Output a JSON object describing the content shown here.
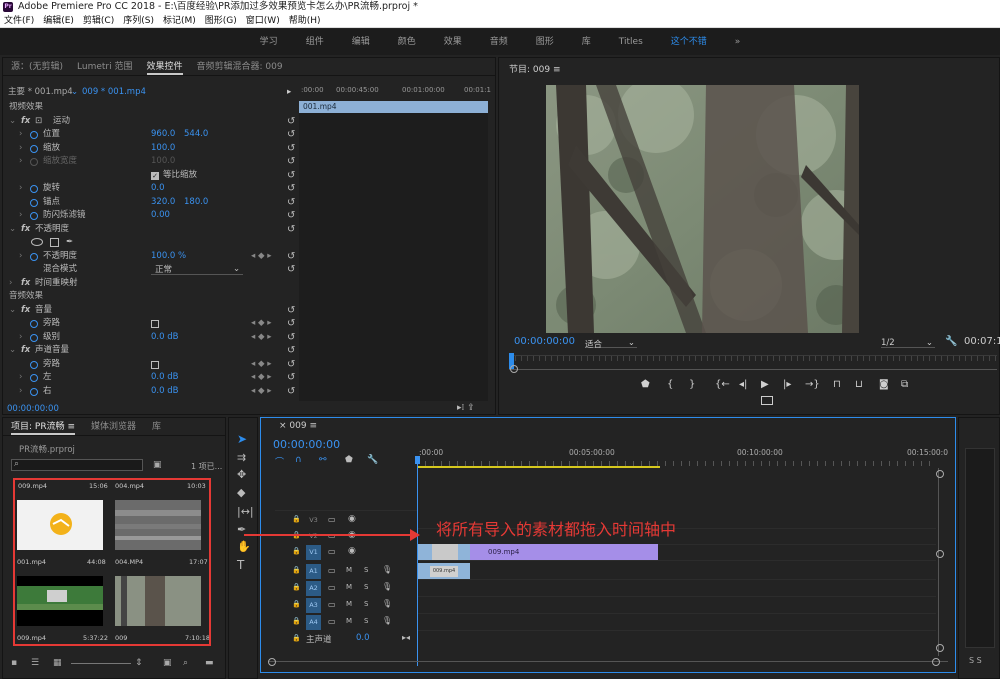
{
  "window": {
    "title": "Adobe Premiere Pro CC 2018 - E:\\百度经验\\PR添加过多效果预览卡怎么办\\PR流畅.prproj *"
  },
  "menu": [
    "文件(F)",
    "编辑(E)",
    "剪辑(C)",
    "序列(S)",
    "标记(M)",
    "图形(G)",
    "窗口(W)",
    "帮助(H)"
  ],
  "workspaces": [
    "学习",
    "组件",
    "编辑",
    "颜色",
    "效果",
    "音频",
    "图形",
    "库",
    "Titles",
    "这个不错",
    "»"
  ],
  "effect_controls": {
    "tabs": [
      "源：(无剪辑)",
      "Lumetri 范围",
      "效果控件",
      "音频剪辑混合器: 009"
    ],
    "master": "主要 * 001.mp4",
    "clip": "009 * 001.mp4",
    "ruler": [
      ":00:00",
      "00:00:45:00",
      "00:01:00:00",
      "00:01:1"
    ],
    "clip_bar": "001.mp4",
    "video_effects": "视频效果",
    "motion": "运动",
    "position": {
      "label": "位置",
      "x": "960.0",
      "y": "544.0"
    },
    "scale": {
      "label": "缩放",
      "value": "100.0"
    },
    "scale_width": {
      "label": "缩放宽度",
      "value": "100.0"
    },
    "uniform": "等比缩放",
    "rotation": {
      "label": "旋转",
      "value": "0.0"
    },
    "anchor": {
      "label": "锚点",
      "x": "320.0",
      "y": "180.0"
    },
    "antiflicker": {
      "label": "防闪烁滤镜",
      "value": "0.00"
    },
    "opacity_fx": "不透明度",
    "opacity": {
      "label": "不透明度",
      "value": "100.0 %"
    },
    "blend": {
      "label": "混合模式",
      "value": "正常"
    },
    "time_remap": "时间重映射",
    "audio_effects": "音频效果",
    "volume_fx": "音量",
    "bypass": "旁路",
    "level": {
      "label": "级别",
      "value": "0.0 dB"
    },
    "channel_volume": "声道音量",
    "bypass2": "旁路",
    "left": {
      "label": "左",
      "value": "0.0 dB"
    },
    "right": {
      "label": "右",
      "value": "0.0 dB"
    },
    "timecode": "00:00:00:00"
  },
  "program": {
    "title": "节目: 009",
    "timecode": "00:00:00:00",
    "fit": "适合",
    "resolution": "1/2",
    "duration": "00:07:11"
  },
  "project": {
    "tabs": [
      "项目: PR流畅",
      "媒体浏览器",
      "库"
    ],
    "file": "PR流畅.prproj",
    "count": "1 项已...",
    "items": [
      {
        "name": "009.mp4",
        "dur": "15:06"
      },
      {
        "name": "004.mp4",
        "dur": "10:03"
      },
      {
        "name": "001.mp4",
        "dur": "44:08"
      },
      {
        "name": "004.MP4",
        "dur": "17:07"
      },
      {
        "name": "009.mp4",
        "dur": "5:37:22"
      },
      {
        "name": "009",
        "dur": "7:10:18"
      }
    ]
  },
  "timeline": {
    "tab": "009",
    "timecode": "00:00:00:00",
    "ruler": [
      ":00:00",
      "00:05:00:00",
      "00:10:00:00",
      "00:15:00:0"
    ],
    "tracks": [
      "V3",
      "V2",
      "V1",
      "A1",
      "A2",
      "A3",
      "A4"
    ],
    "master": "主声道",
    "master_value": "0.0",
    "clip_v1": "009.mp4",
    "clip_a1": "009.mp4"
  },
  "annotation": "将所有导入的素材都拖入时间轴中",
  "colors": {
    "accent": "#2d8ceb",
    "clip_purple": "#a58ee8",
    "clip_blue": "#8fb4d9",
    "annotation": "#e53935"
  }
}
